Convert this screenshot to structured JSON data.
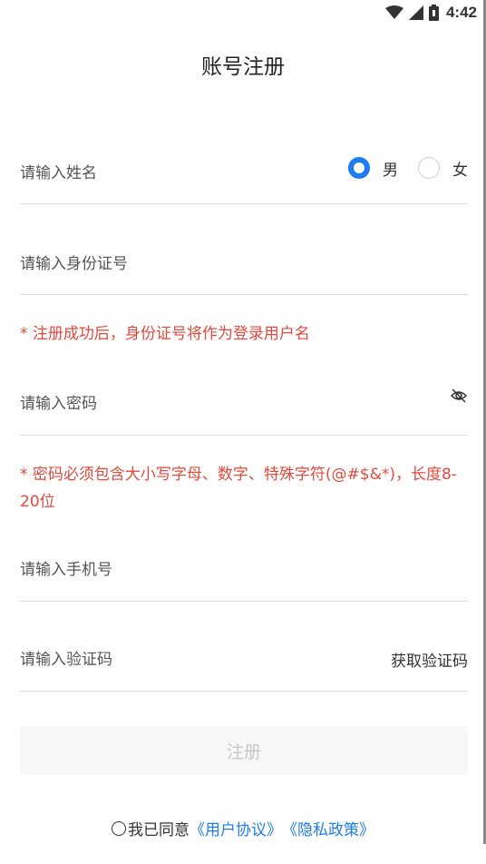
{
  "status_bar": {
    "time": "4:42",
    "icons": [
      "wifi-icon",
      "cell-signal-icon",
      "battery-icon"
    ]
  },
  "page": {
    "title": "账号注册"
  },
  "form": {
    "name_placeholder": "请输入姓名",
    "gender": {
      "male": "男",
      "female": "女",
      "selected": "male"
    },
    "id_placeholder": "请输入身份证号",
    "id_hint": "* 注册成功后，身份证号将作为登录用户名",
    "password_placeholder": "请输入密码",
    "password_hint": "* 密码必须包含大小写字母、数字、特殊字符(@#$&*)，长度8-20位",
    "phone_placeholder": "请输入手机号",
    "code_placeholder": "请输入验证码",
    "get_code_label": "获取验证码",
    "register_label": "注册"
  },
  "agreement": {
    "prefix": "我已同意",
    "user_agreement": "《用户协议》",
    "privacy_policy": "《隐私政策》"
  },
  "colors": {
    "accent": "#1f7bf2",
    "hint": "#e04a3f",
    "divider": "#dcdcdc",
    "disabled_text": "#c8c8c8"
  }
}
